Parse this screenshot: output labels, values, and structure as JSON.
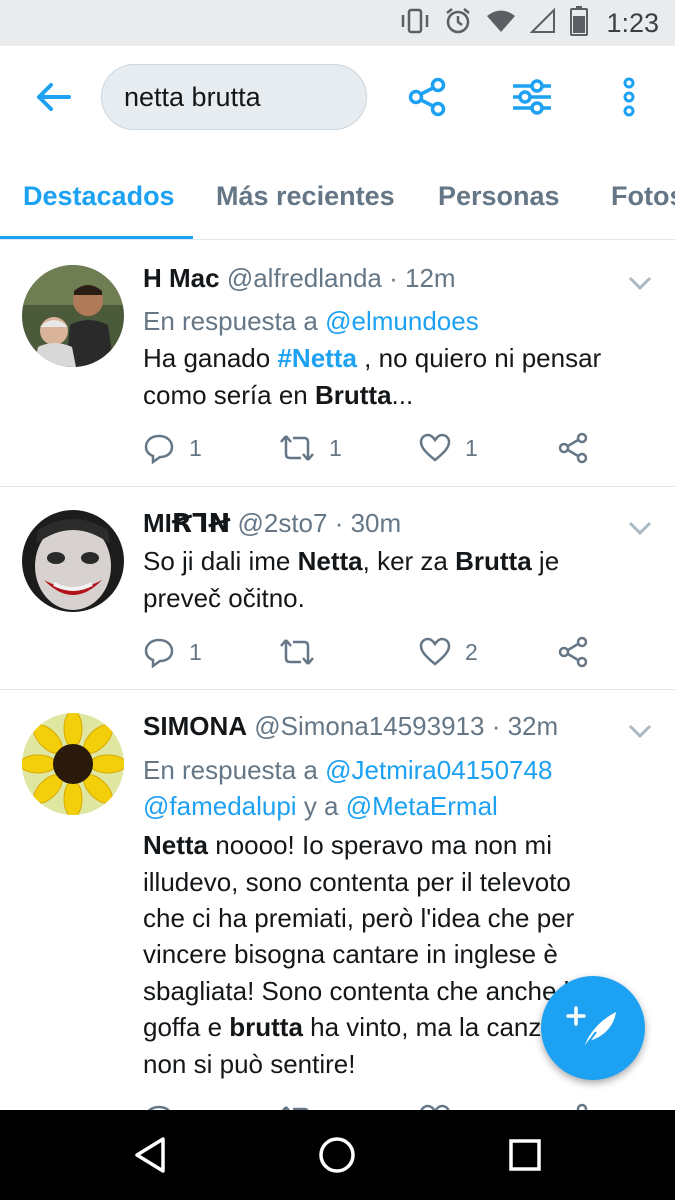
{
  "status_bar": {
    "time": "1:23",
    "icons": [
      "vibrate-icon",
      "alarm-icon",
      "wifi-icon",
      "signal-icon",
      "battery-icon"
    ]
  },
  "app_bar": {
    "search_value": "netta brutta",
    "icons": [
      "back-arrow-icon",
      "share-icon",
      "filter-icon",
      "more-icon"
    ]
  },
  "tabs": [
    {
      "label": "Destacados",
      "active": true
    },
    {
      "label": "Más recientes",
      "active": false
    },
    {
      "label": "Personas",
      "active": false
    },
    {
      "label": "Fotos",
      "active": false
    }
  ],
  "tweets": [
    {
      "name": "H Mac",
      "handle": "@alfredlanda",
      "time": "· 12m",
      "reply_prefix": "En respuesta a ",
      "reply_to_1": "@elmundoes",
      "body": {
        "l1a": "Ha ganado ",
        "l1b": "#Netta",
        "l1c": " , no quiero ni pensar",
        "l2a": "como sería en ",
        "l2b": "Brutta",
        "l2c": "..."
      },
      "replies": "1",
      "retweets": "1",
      "likes": "1"
    },
    {
      "name": "MIꞦꞀꞤ",
      "handle": "@2sto7",
      "time": "· 30m",
      "body": {
        "l1a": "So ji dali ime ",
        "l1b": "Netta",
        "l1c": ", ker za ",
        "l1d": "Brutta",
        "l1e": " je",
        "l2a": "preveč očitno."
      },
      "replies": "1",
      "retweets": "",
      "likes": "2"
    },
    {
      "name": "SIMONA",
      "handle": "@Simona14593913",
      "time": "· 32m",
      "reply_prefix": "En respuesta a ",
      "reply_to_1": "@Jetmira04150748",
      "reply_to_2": "@famedalupi",
      "reply_joiner": " y a ",
      "reply_to_3": "@MetaErmal",
      "body": {
        "l1a": "Netta",
        "l1b": " noooo! Io speravo ma non mi",
        "l2": "illudevo, sono contenta per il televoto",
        "l3": "che ci ha premiati, però l'idea che per",
        "l4": "vincere bisogna cantare in inglese è",
        "l5": "sbagliata! Sono contenta che anche la",
        "l6a": "goffa e ",
        "l6b": "brutta",
        "l6c": " ha vinto, ma la canzone",
        "l7": "non si può sentire!"
      }
    }
  ],
  "colors": {
    "accent": "#1da1f2",
    "text": "#14171a",
    "secondary": "#657786",
    "divider": "#e1e8ed"
  }
}
